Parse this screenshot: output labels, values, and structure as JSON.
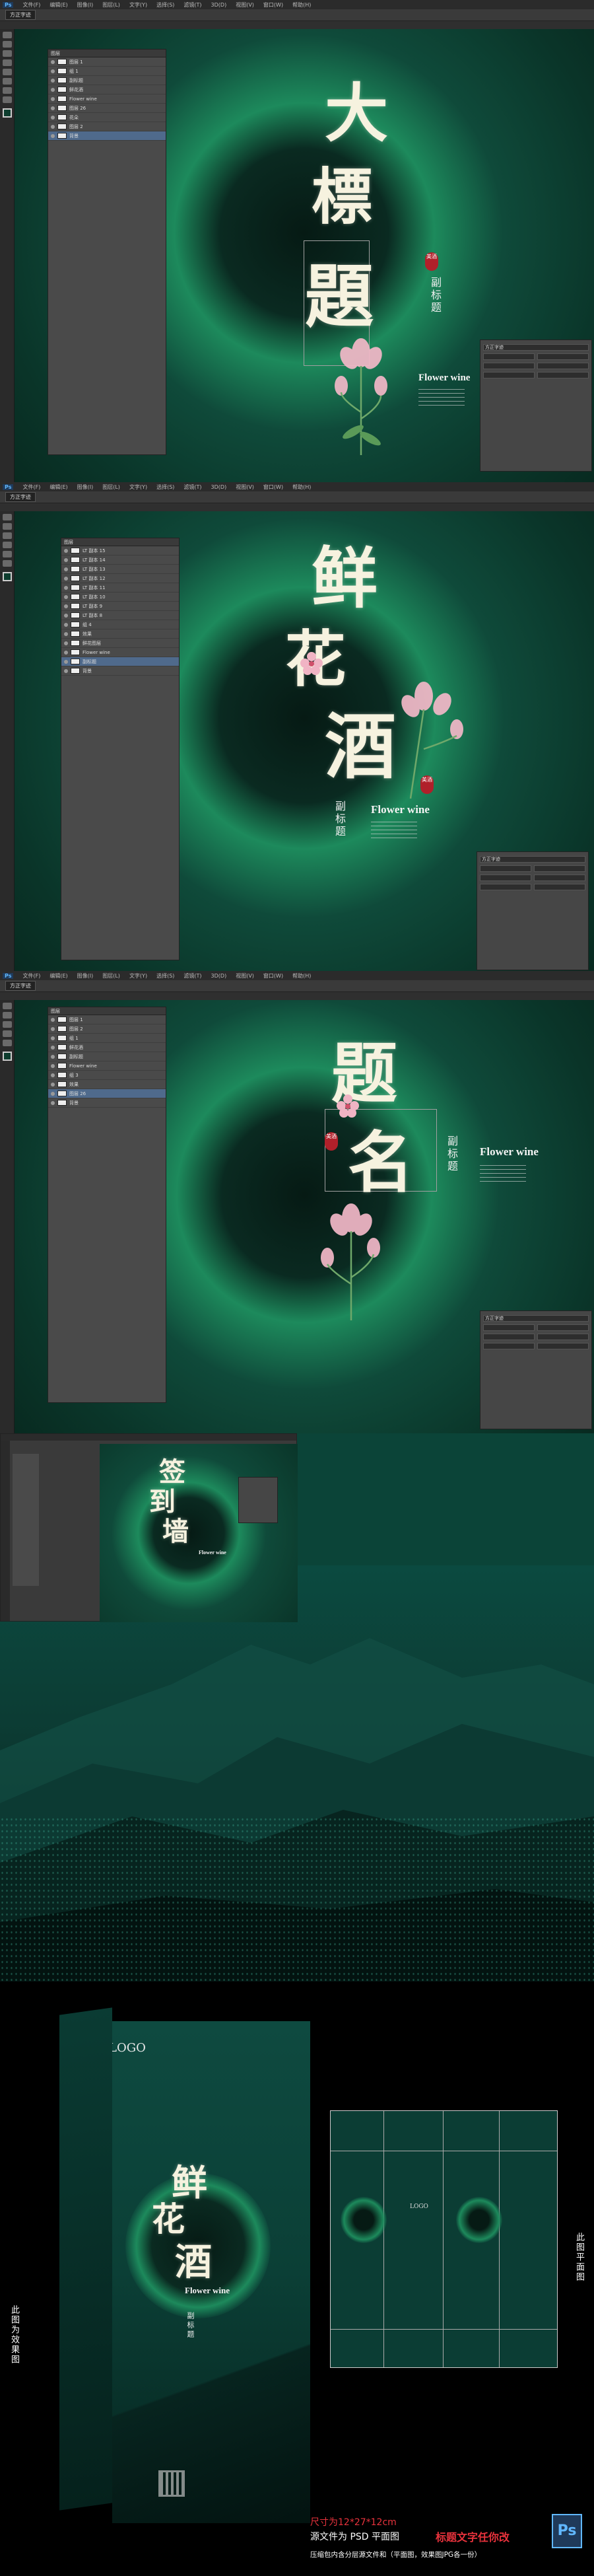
{
  "app": {
    "logo": "Ps",
    "menus": [
      "文件(F)",
      "编辑(E)",
      "图像(I)",
      "图层(L)",
      "文字(Y)",
      "选择(S)",
      "滤镜(T)",
      "3D(D)",
      "视图(V)",
      "窗口(W)",
      "帮助(H)"
    ]
  },
  "panel1": {
    "title_chars": [
      "大",
      "標",
      "題"
    ],
    "subtitle": "副标题",
    "seal": "美酒",
    "english": "Flower wine",
    "font_name": "方正字迹",
    "layers_header": "图层",
    "layers": [
      "图层 1",
      "组 1",
      "副标题",
      "鲜花酒",
      "Flower wine",
      "图层 26",
      "花朵",
      "图层 2",
      "背景"
    ]
  },
  "panel2": {
    "title_chars": [
      "鲜",
      "花",
      "酒"
    ],
    "subtitle": "副标题",
    "seal": "美酒",
    "english": "Flower wine",
    "font_name": "方正字迹",
    "layers_header": "图层",
    "layers": [
      "LT 副本 15",
      "LT 副本 14",
      "LT 副本 13",
      "LT 副本 12",
      "LT 副本 11",
      "LT 副本 10",
      "LT 副本 9",
      "LT 副本 8",
      "组 4",
      "效果",
      "鲜花图层",
      "Flower wine",
      "副标题",
      "背景"
    ]
  },
  "panel3": {
    "title_chars": [
      "题",
      "名"
    ],
    "subtitle": "副标题",
    "seal": "美酒",
    "english": "Flower wine",
    "font_name": "方正字迹",
    "layers_header": "图层",
    "layers": [
      "图层 1",
      "图层 2",
      "组 1",
      "鲜花酒",
      "副标题",
      "Flower wine",
      "组 3",
      "效果",
      "图层 26",
      "背景"
    ]
  },
  "panel4": {
    "title_chars": [
      "签",
      "到",
      "墙"
    ],
    "english": "Flower wine"
  },
  "mockup": {
    "box_logo": "LOGO",
    "box_title_chars": [
      "鲜",
      "花",
      "酒"
    ],
    "box_english": "Flower wine",
    "box_subtitle": "副标题",
    "flat_logo": "LOGO",
    "label_left": "此图为效果图",
    "label_right": "此图平面图",
    "size_line": "尺寸为12*27*12cm",
    "source_line": "源文件为 PSD 平面图",
    "edit_note": "标题文字任你改",
    "pack_line": "压缩包内含分层源文件和（平面图，效果图JPG各一份）",
    "ps_icon": "Ps"
  },
  "colors": {
    "bg_green": "#0d3b30",
    "glow_green": "#1d8a5c",
    "seal_red": "#b0202a",
    "accent_red": "#e8323c",
    "ps_blue": "#1f3a5a"
  }
}
